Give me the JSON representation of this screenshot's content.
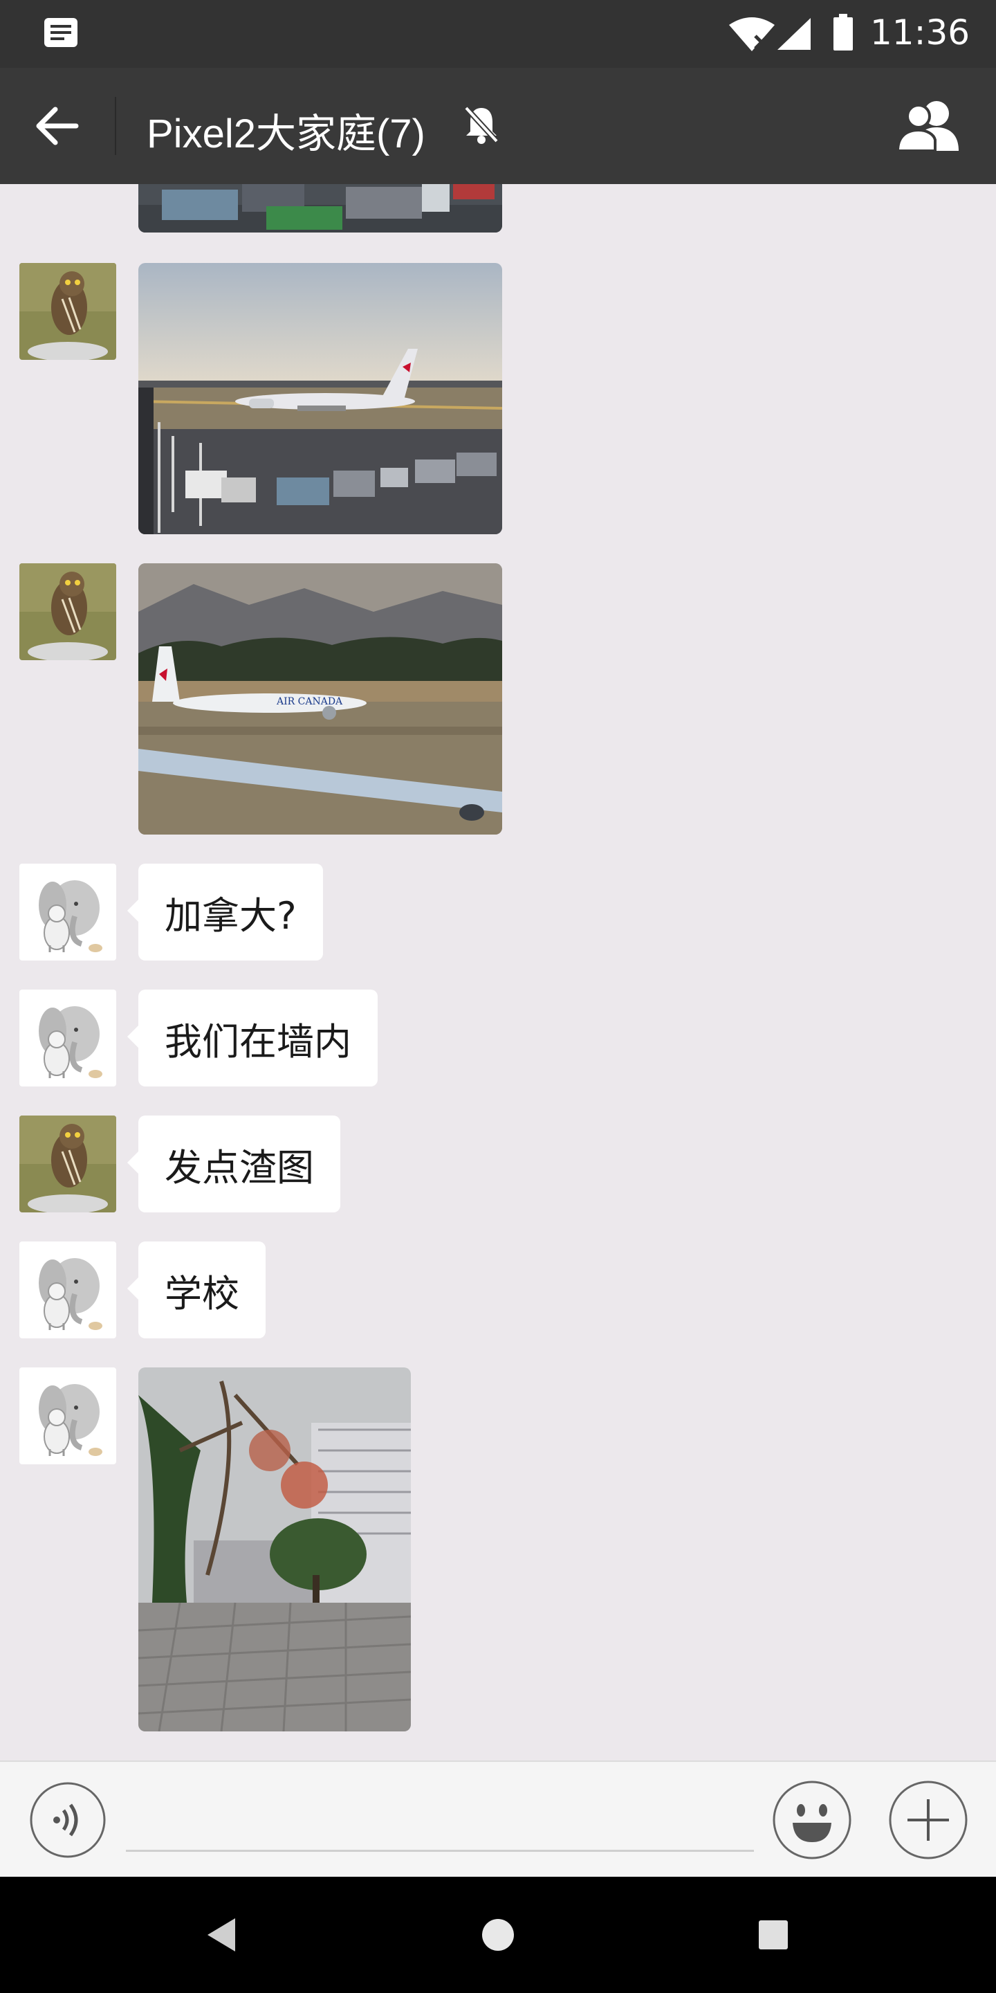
{
  "status_bar": {
    "time": "11:36",
    "icons": [
      "notification-icon",
      "wifi-x-icon",
      "signal-icon",
      "battery-icon"
    ]
  },
  "header": {
    "title": "Pixel2大家庭(7)",
    "back_icon": "arrow-left-icon",
    "mute_icon": "bell-off-icon",
    "members_icon": "group-icon"
  },
  "messages": [
    {
      "sender": "owl",
      "type": "image",
      "image": "airport cargo (partial)"
    },
    {
      "sender": "owl",
      "type": "image",
      "image": "air canada plane at gate"
    },
    {
      "sender": "owl",
      "type": "image",
      "image": "air canada plane on runway"
    },
    {
      "sender": "elephant",
      "type": "text",
      "text": "加拿大?"
    },
    {
      "sender": "elephant",
      "type": "text",
      "text": "我们在墙内"
    },
    {
      "sender": "owl",
      "type": "text",
      "text": "发点渣图"
    },
    {
      "sender": "elephant",
      "type": "text",
      "text": "学校"
    },
    {
      "sender": "elephant",
      "type": "image",
      "image": "campus trees and buildings"
    }
  ],
  "input_bar": {
    "placeholder": "",
    "voice_icon": "voice-icon",
    "emoji_icon": "emoji-icon",
    "more_icon": "plus-icon"
  },
  "nav_bar": {
    "icons": [
      "nav-back-icon",
      "nav-home-icon",
      "nav-recents-icon"
    ]
  },
  "colors": {
    "status_bar": "#333333",
    "header": "#393939",
    "chat_background": "#ece8ec",
    "bubble": "#ffffff",
    "input_bar": "#f5f5f5"
  }
}
